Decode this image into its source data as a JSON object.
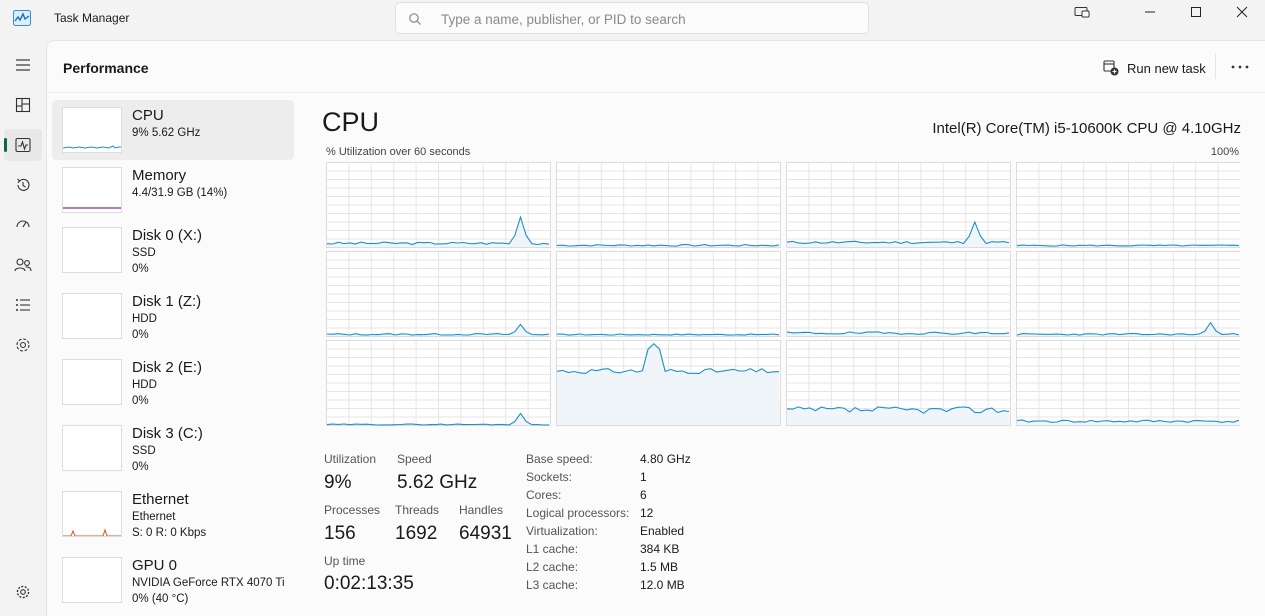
{
  "window": {
    "title": "Task Manager"
  },
  "search": {
    "placeholder": "Type a name, publisher, or PID to search"
  },
  "header": {
    "title": "Performance",
    "run_task_label": "Run new task"
  },
  "rail": [
    "menu-icon",
    "processes-icon",
    "performance-icon",
    "app-history-icon",
    "startup-apps-icon",
    "users-icon",
    "details-icon",
    "services-icon",
    "settings-icon"
  ],
  "devices": [
    {
      "name": "CPU",
      "line2": "9%  5.62 GHz",
      "line3": ""
    },
    {
      "name": "Memory",
      "line2": "4.4/31.9 GB (14%)",
      "line3": ""
    },
    {
      "name": "Disk 0 (X:)",
      "line2": "SSD",
      "line3": "0%"
    },
    {
      "name": "Disk 1 (Z:)",
      "line2": "HDD",
      "line3": "0%"
    },
    {
      "name": "Disk 2 (E:)",
      "line2": "HDD",
      "line3": "0%"
    },
    {
      "name": "Disk 3 (C:)",
      "line2": "SSD",
      "line3": "0%"
    },
    {
      "name": "Ethernet",
      "line2": "Ethernet",
      "line3": "S: 0  R: 0 Kbps"
    },
    {
      "name": "GPU 0",
      "line2": "NVIDIA GeForce RTX 4070 Ti",
      "line3": "0%  (40 °C)"
    }
  ],
  "cpu": {
    "title": "CPU",
    "model": "Intel(R) Core(TM) i5-10600K CPU @ 4.10GHz",
    "graph_label": "% Utilization over 60 seconds",
    "graph_max": "100%",
    "stats": {
      "utilization_label": "Utilization",
      "utilization": "9%",
      "speed_label": "Speed",
      "speed": "5.62 GHz",
      "processes_label": "Processes",
      "processes": "156",
      "threads_label": "Threads",
      "threads": "1692",
      "handles_label": "Handles",
      "handles": "64931",
      "uptime_label": "Up time",
      "uptime": "0:02:13:35"
    },
    "info": [
      {
        "k": "Base speed:",
        "v": "4.80 GHz"
      },
      {
        "k": "Sockets:",
        "v": "1"
      },
      {
        "k": "Cores:",
        "v": "6"
      },
      {
        "k": "Logical processors:",
        "v": "12"
      },
      {
        "k": "Virtualization:",
        "v": "Enabled"
      },
      {
        "k": "L1 cache:",
        "v": "384 KB"
      },
      {
        "k": "L2 cache:",
        "v": "1.5 MB"
      },
      {
        "k": "L3 cache:",
        "v": "12.0 MB"
      }
    ]
  },
  "colors": {
    "cpu_line": "#1a8fd0",
    "memory_line": "#8b2a9e",
    "ethernet_line": "#d9541e",
    "grid": "#e6e6e6",
    "fill": "#eef4fa"
  }
}
